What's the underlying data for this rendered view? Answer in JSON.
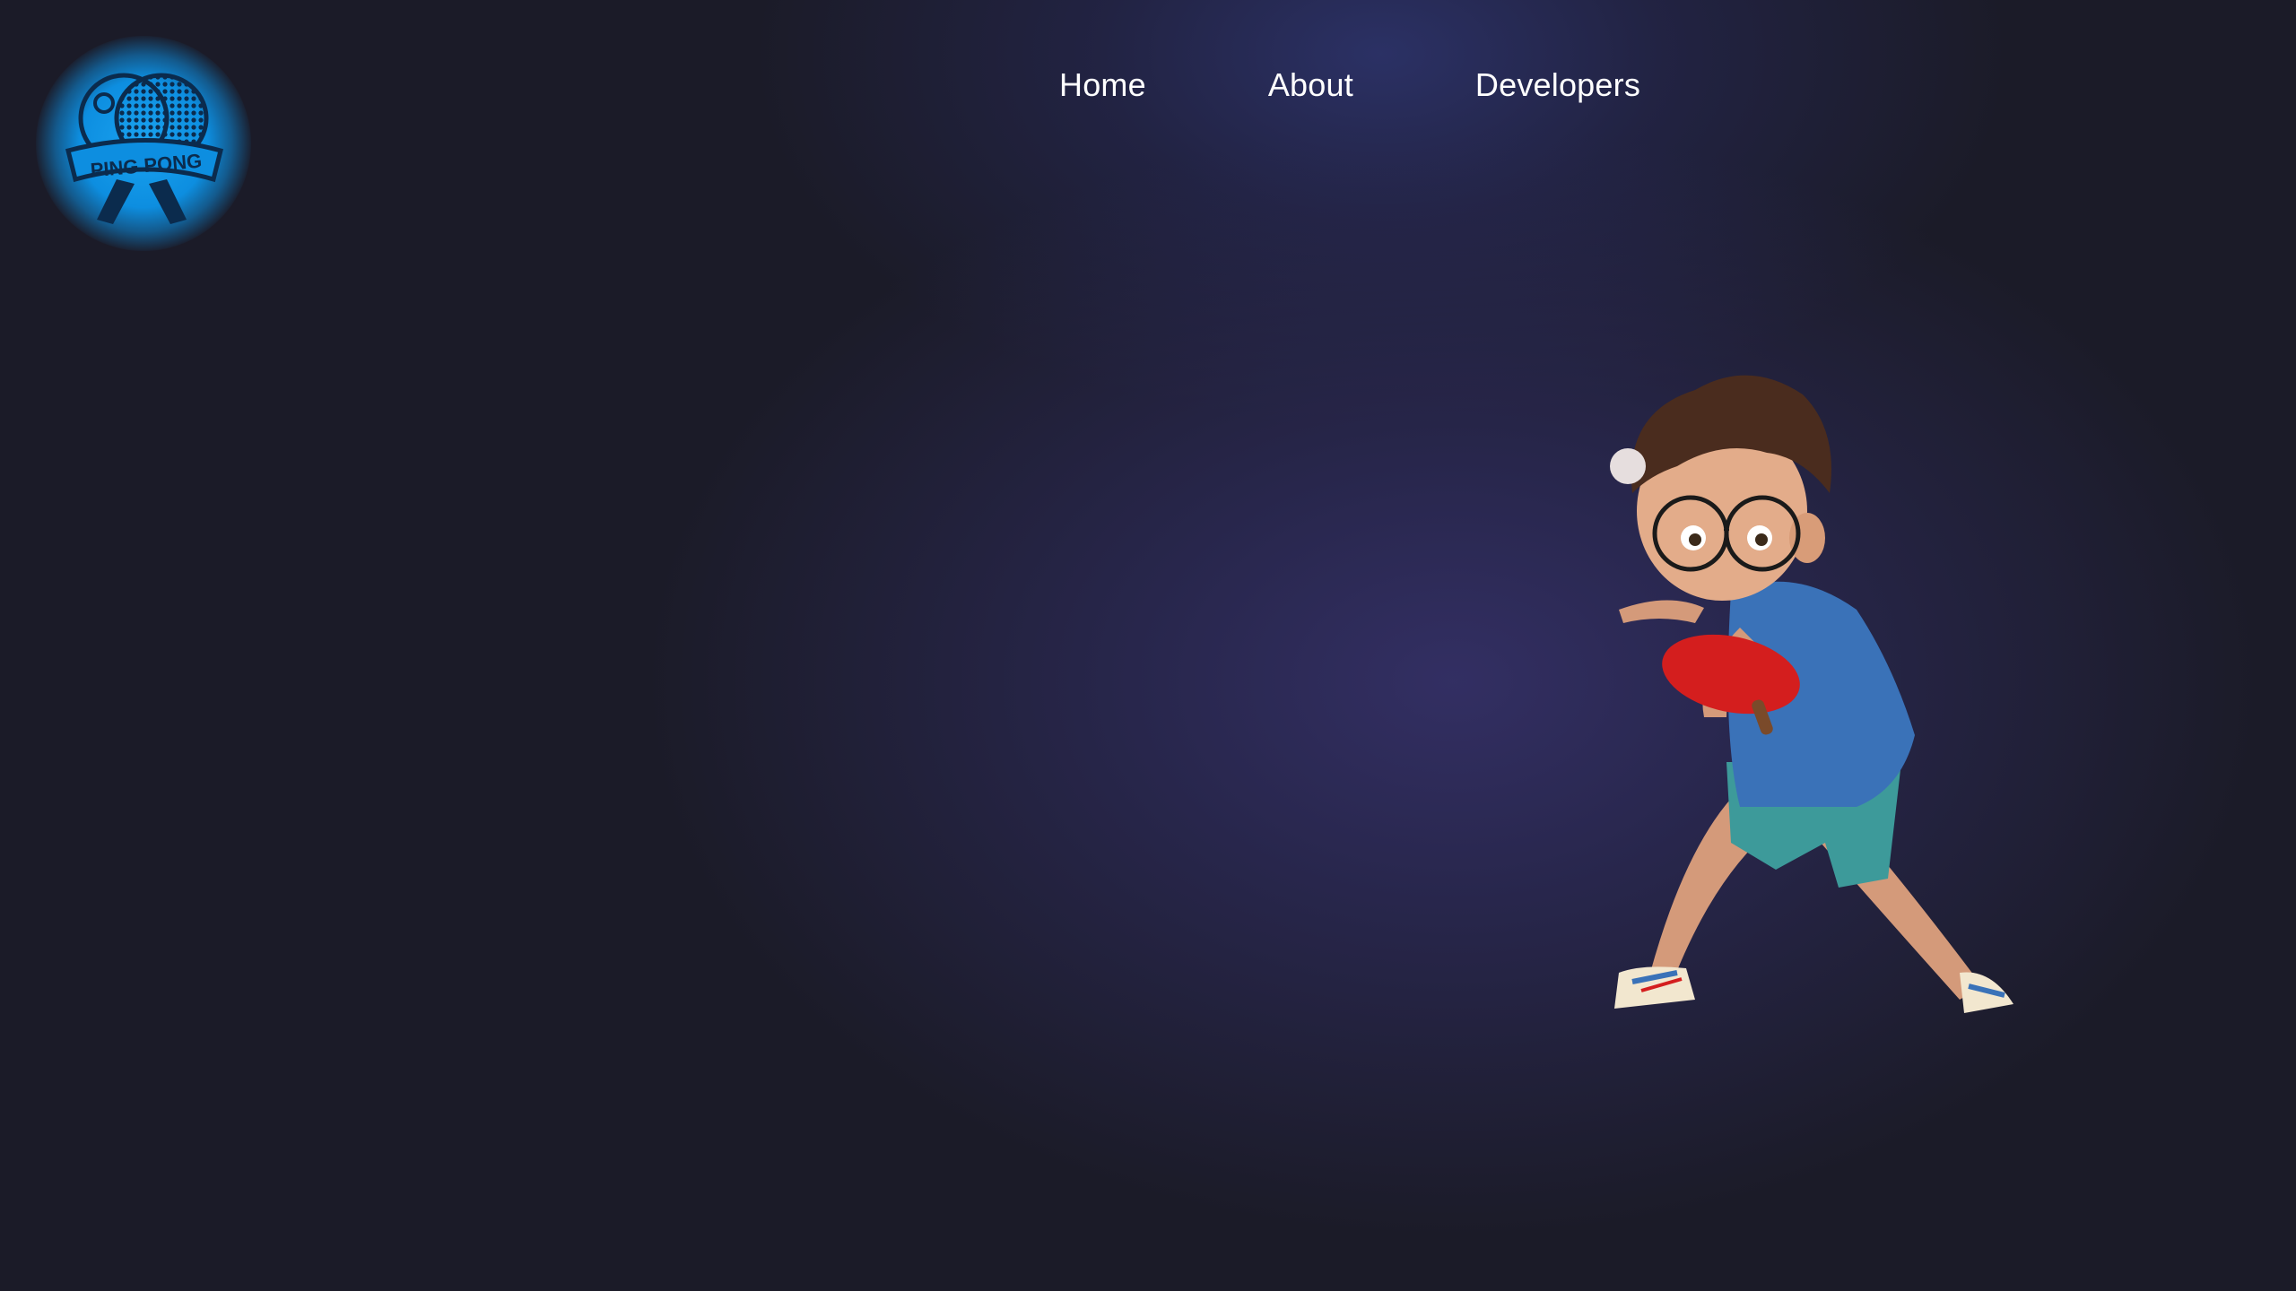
{
  "logo": {
    "text": "PING PONG",
    "icon": "ping-pong-paddle-logo"
  },
  "nav": {
    "items": [
      {
        "label": "Home"
      },
      {
        "label": "About"
      },
      {
        "label": "Developers"
      }
    ]
  },
  "hero": {
    "icon": "cartoon-boy-playing-ping-pong"
  },
  "colors": {
    "background": "#1b1b28",
    "glow": "#3a3a78",
    "logo_accent": "#0d8ee0",
    "nav_text": "#ffffff",
    "paddle": "#d41e1e",
    "shirt": "#3a72b8",
    "shorts": "#3d9a9a"
  }
}
